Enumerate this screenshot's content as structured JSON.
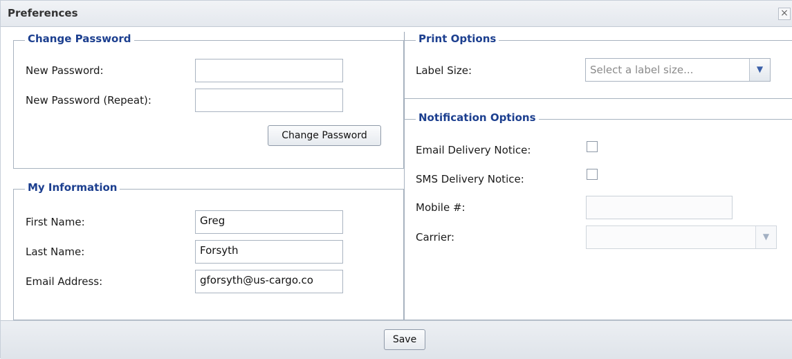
{
  "window": {
    "title": "Preferences",
    "close_glyph": "×"
  },
  "change_password": {
    "legend": "Change Password",
    "new_password_label": "New Password:",
    "new_password_value": "",
    "repeat_label": "New Password (Repeat):",
    "repeat_value": "",
    "button_label": "Change Password"
  },
  "my_information": {
    "legend": "My Information",
    "first_name_label": "First Name:",
    "first_name_value": "Greg",
    "last_name_label": "Last Name:",
    "last_name_value": "Forsyth",
    "email_label": "Email Address:",
    "email_value": "gforsyth@us-cargo.co"
  },
  "print_options": {
    "legend": "Print Options",
    "label_size_label": "Label Size:",
    "label_size_placeholder": "Select a label size..."
  },
  "notification_options": {
    "legend": "Notification Options",
    "email_notice_label": "Email Delivery Notice:",
    "email_notice_checked": false,
    "sms_notice_label": "SMS Delivery Notice:",
    "sms_notice_checked": false,
    "mobile_label": "Mobile #:",
    "mobile_value": "",
    "carrier_label": "Carrier:",
    "carrier_value": ""
  },
  "footer": {
    "save_label": "Save"
  },
  "icons": {
    "close": "close-icon",
    "dropdown": "chevron-down-icon"
  },
  "colors": {
    "legend_text": "#1c3f8f",
    "border": "#a7b2bf",
    "titlebar": "#e4e8ee"
  }
}
